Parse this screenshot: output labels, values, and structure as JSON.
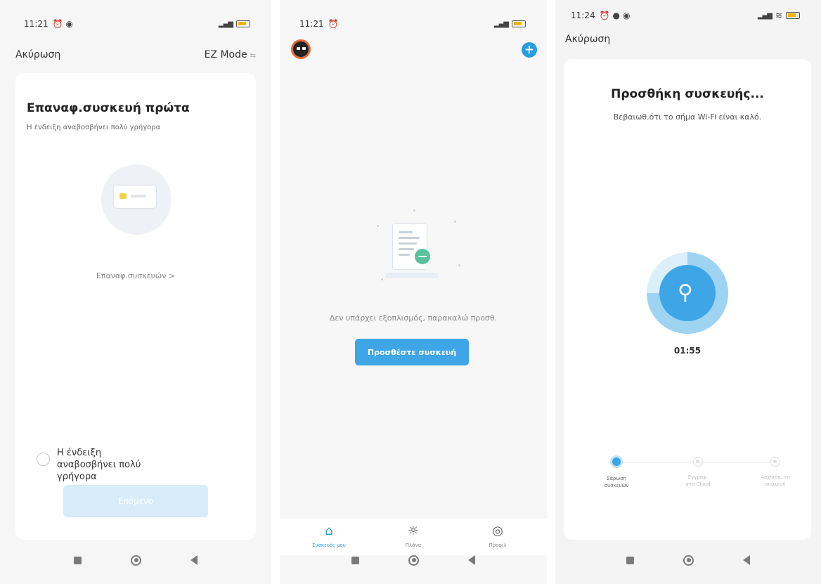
{
  "panel1": {
    "status": {
      "time": "11:21"
    },
    "header": {
      "cancel": "Ακύρωση",
      "mode": "EZ Mode",
      "mode_suffix": "⇆"
    },
    "title": "Επαναφ.συσκευή πρώτα",
    "subtitle": "Η ένδειξη αναβοσβήνει πολύ γρήγορα",
    "reset_link": "Επαναφ.συσκευών >",
    "confirm_text": "Η ένδειξη αναβοσβήνει πολύ γρήγορα",
    "next_button": "Επόμενο"
  },
  "panel2": {
    "status": {
      "time": "11:21"
    },
    "empty_text": "Δεν υπάρχει εξοπλισμός, παρακαλώ προσθ.",
    "add_button": "Προσθέστε συσκευή",
    "tabs": [
      {
        "label": "Συσκευές μου",
        "icon": "home-icon"
      },
      {
        "label": "Πλάνα",
        "icon": "sun-icon"
      },
      {
        "label": "Προφίλ",
        "icon": "profile-icon"
      }
    ]
  },
  "panel3": {
    "status": {
      "time": "11:24"
    },
    "cancel": "Ακύρωση",
    "title": "Προσθήκη συσκευής...",
    "subtitle": "Βεβαιωθ.ότι το σήμα Wi-Fi είναι καλό.",
    "timer": "01:55",
    "progress": 0.75,
    "steps": [
      {
        "label1": "Σάρωση",
        "label2": "συσκευών"
      },
      {
        "label1": "Εγγραφ.",
        "label2": "στο Cloud"
      },
      {
        "label1": "Αρχικοπ. τη",
        "label2": "συσκευή"
      }
    ]
  },
  "colors": {
    "accent": "#3ea6e6",
    "accent_light": "#d7ecf8"
  }
}
